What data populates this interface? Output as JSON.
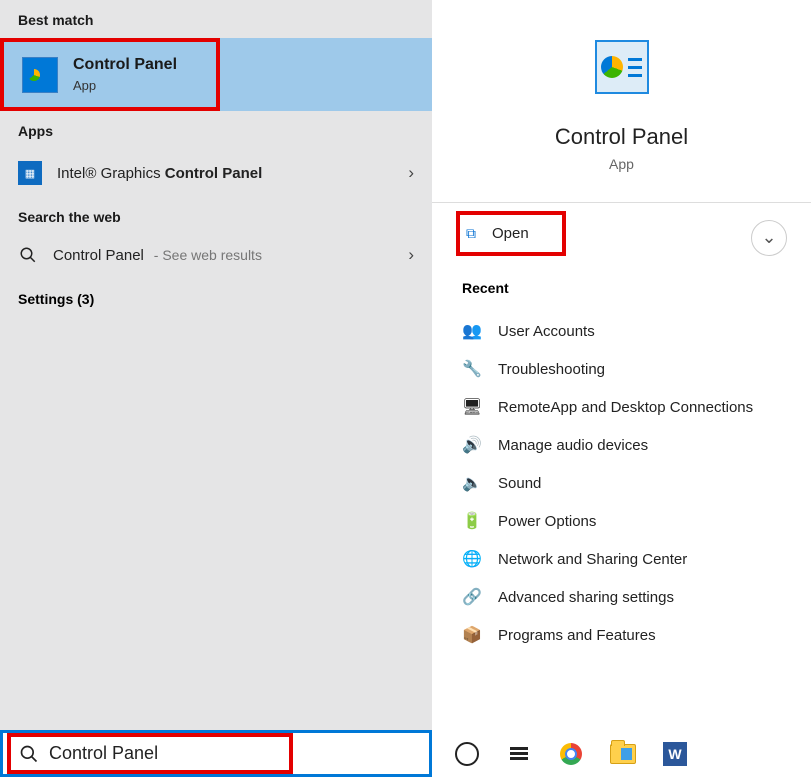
{
  "sections": {
    "best_match_header": "Best match",
    "apps_header": "Apps",
    "web_header": "Search the web",
    "settings_header": "Settings (3)",
    "recent_header": "Recent"
  },
  "best_match": {
    "title": "Control Panel",
    "subtitle": "App"
  },
  "apps": {
    "intel_prefix": "Intel® Graphics ",
    "intel_bold": "Control Panel"
  },
  "web": {
    "label": "Control Panel",
    "suffix": " - See web results"
  },
  "hero": {
    "title": "Control Panel",
    "subtitle": "App"
  },
  "open": {
    "label": "Open"
  },
  "recent": [
    {
      "icon": "👥",
      "label": "User Accounts"
    },
    {
      "icon": "🔧",
      "label": "Troubleshooting"
    },
    {
      "icon": "🖥",
      "label": "RemoteApp and Desktop Connections"
    },
    {
      "icon": "🔊",
      "label": "Manage audio devices"
    },
    {
      "icon": "🔈",
      "label": "Sound"
    },
    {
      "icon": "🔋",
      "label": "Power Options"
    },
    {
      "icon": "🌐",
      "label": "Network and Sharing Center"
    },
    {
      "icon": "🔗",
      "label": "Advanced sharing settings"
    },
    {
      "icon": "📦",
      "label": "Programs and Features"
    }
  ],
  "searchbar": {
    "value": "Control Panel"
  }
}
